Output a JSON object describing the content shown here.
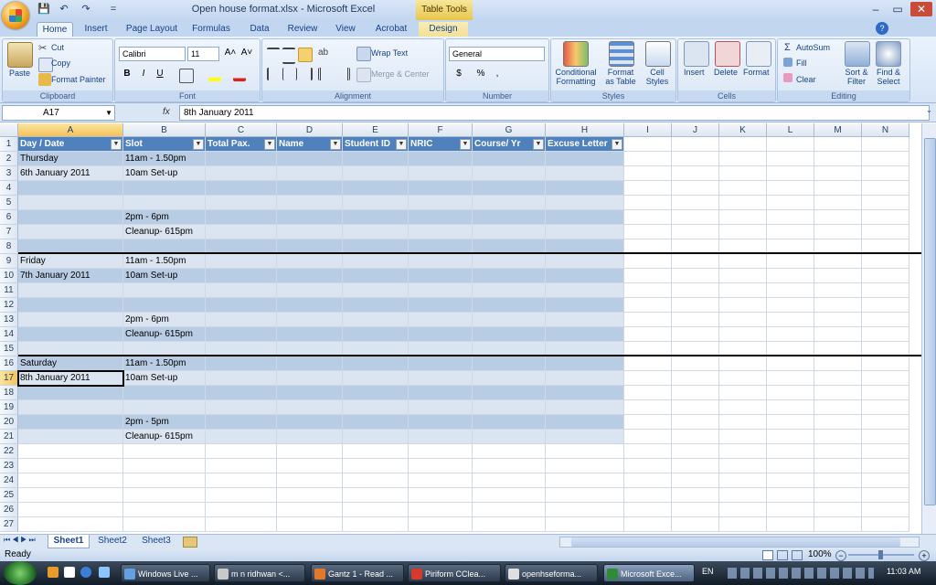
{
  "window": {
    "title": "Open house format.xlsx - Microsoft Excel",
    "contextual_tab": "Table Tools",
    "min": "–",
    "max": "▭",
    "close": "✕"
  },
  "qat": [
    "💾",
    "↶",
    "↷",
    "="
  ],
  "tabs": [
    "Home",
    "Insert",
    "Page Layout",
    "Formulas",
    "Data",
    "Review",
    "View",
    "Acrobat",
    "Design"
  ],
  "ribbon": {
    "clipboard": {
      "label": "Clipboard",
      "paste": "Paste",
      "cut": "Cut",
      "copy": "Copy",
      "format_painter": "Format Painter"
    },
    "font": {
      "label": "Font",
      "name": "Calibri",
      "size": "11",
      "bold": "B",
      "italic": "I",
      "underline": "U",
      "grow": "A˄",
      "shrink": "A˅"
    },
    "alignment": {
      "label": "Alignment",
      "wrap": "Wrap Text",
      "merge": "Merge & Center"
    },
    "number": {
      "label": "Number",
      "format": "General",
      "currency": "$",
      "percent": "%",
      "comma": ","
    },
    "styles": {
      "label": "Styles",
      "conditional": "Conditional Formatting",
      "format_table": "Format as Table",
      "cell_styles": "Cell Styles"
    },
    "cells": {
      "label": "Cells",
      "insert": "Insert",
      "delete": "Delete",
      "format": "Format"
    },
    "editing": {
      "label": "Editing",
      "autosum": "AutoSum",
      "fill": "Fill",
      "clear": "Clear",
      "sort": "Sort & Filter",
      "find": "Find & Select"
    }
  },
  "formula_bar": {
    "name_box": "A17",
    "fx": "fx",
    "content": "8th January 2011"
  },
  "columns": [
    "A",
    "B",
    "C",
    "D",
    "E",
    "F",
    "G",
    "H",
    "I",
    "J",
    "K",
    "L",
    "M",
    "N"
  ],
  "table_headers": [
    "Day / Date",
    "Slot",
    "Total Pax.",
    "Name",
    "Student ID",
    "NRIC",
    "Course/ Yr",
    "Excuse Letter"
  ],
  "rows": [
    {
      "n": "1"
    },
    {
      "n": "2",
      "a": "Thursday",
      "b": "11am - 1.50pm"
    },
    {
      "n": "3",
      "a": "6th January 2011",
      "b": "10am Set-up"
    },
    {
      "n": "4"
    },
    {
      "n": "5"
    },
    {
      "n": "6",
      "b": "2pm - 6pm"
    },
    {
      "n": "7",
      "b": "Cleanup- 615pm"
    },
    {
      "n": "8"
    },
    {
      "n": "9",
      "a": "Friday",
      "b": "11am - 1.50pm"
    },
    {
      "n": "10",
      "a": "7th January 2011",
      "b": "10am Set-up"
    },
    {
      "n": "11"
    },
    {
      "n": "12"
    },
    {
      "n": "13",
      "b": "2pm - 6pm"
    },
    {
      "n": "14",
      "b": "Cleanup- 615pm"
    },
    {
      "n": "15"
    },
    {
      "n": "16",
      "a": "Saturday",
      "b": "11am - 1.50pm"
    },
    {
      "n": "17",
      "a": "8th January 2011",
      "b": "10am Set-up"
    },
    {
      "n": "18"
    },
    {
      "n": "19"
    },
    {
      "n": "20",
      "b": "2pm - 5pm"
    },
    {
      "n": "21",
      "b": "Cleanup- 615pm"
    },
    {
      "n": "22"
    },
    {
      "n": "23"
    },
    {
      "n": "24"
    },
    {
      "n": "25"
    },
    {
      "n": "26"
    },
    {
      "n": "27"
    }
  ],
  "sheets": [
    "Sheet1",
    "Sheet2",
    "Sheet3"
  ],
  "status": {
    "ready": "Ready",
    "zoom": "100%"
  },
  "taskbar": {
    "items": [
      "Windows Live ...",
      "m n ridhwan <...",
      "Gantz 1 - Read ...",
      "Piriform CClea...",
      "openhseforma...",
      "Microsoft Exce..."
    ],
    "lang": "EN",
    "clock": "11:03 AM"
  }
}
